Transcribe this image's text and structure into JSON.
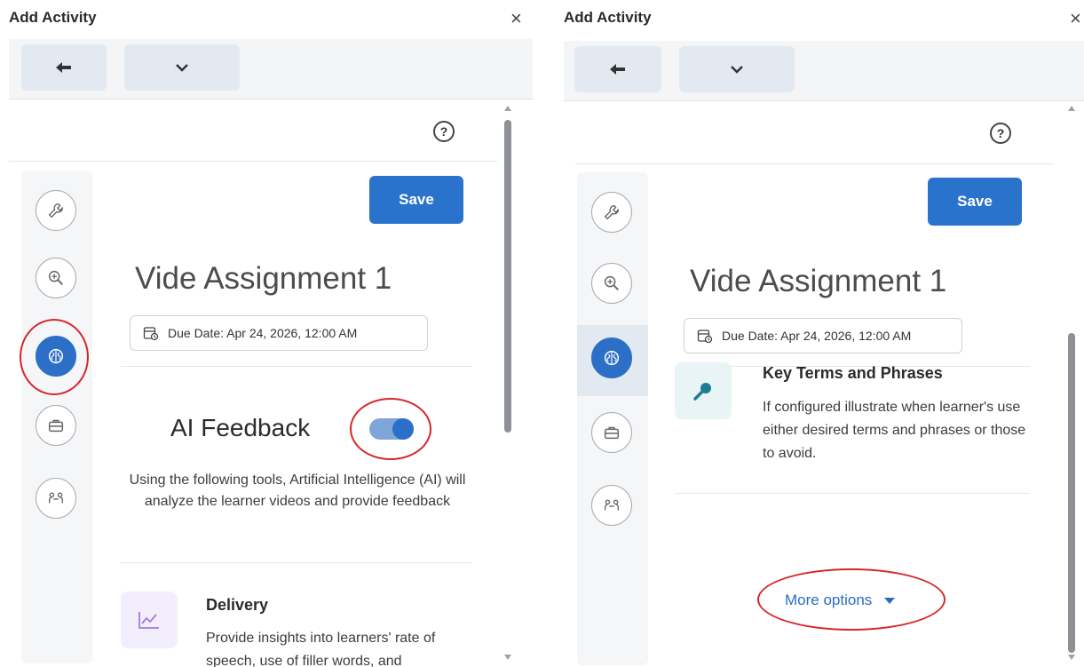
{
  "dialog": {
    "title": "Add Activity",
    "close_label": "×"
  },
  "activity": {
    "save_label": "Save",
    "assignment_title": "Vide Assignment 1",
    "due_date": "Due Date: Apr 24, 2026, 12:00 AM",
    "help_label": "?"
  },
  "ai_feedback": {
    "title": "AI Feedback",
    "enabled": true,
    "description": "Using the following tools, Artificial Intelligence (AI) will analyze the learner videos and provide feedback"
  },
  "features": {
    "delivery": {
      "title": "Delivery",
      "description": "Provide insights into learners' rate of speech, use of filler words, and"
    },
    "key_terms": {
      "title": "Key Terms and Phrases",
      "description": "If configured illustrate when learner's use either desired terms and phrases or those to avoid."
    }
  },
  "more_options": {
    "label": "More options"
  },
  "sidebar": {
    "items": [
      {
        "icon": "wrench-icon"
      },
      {
        "icon": "search-zoom-icon"
      },
      {
        "icon": "ai-brain-icon",
        "active": true
      },
      {
        "icon": "briefcase-icon"
      },
      {
        "icon": "people-icon"
      }
    ]
  },
  "colors": {
    "accent": "#2a73cc",
    "annotation": "#d7262b"
  }
}
